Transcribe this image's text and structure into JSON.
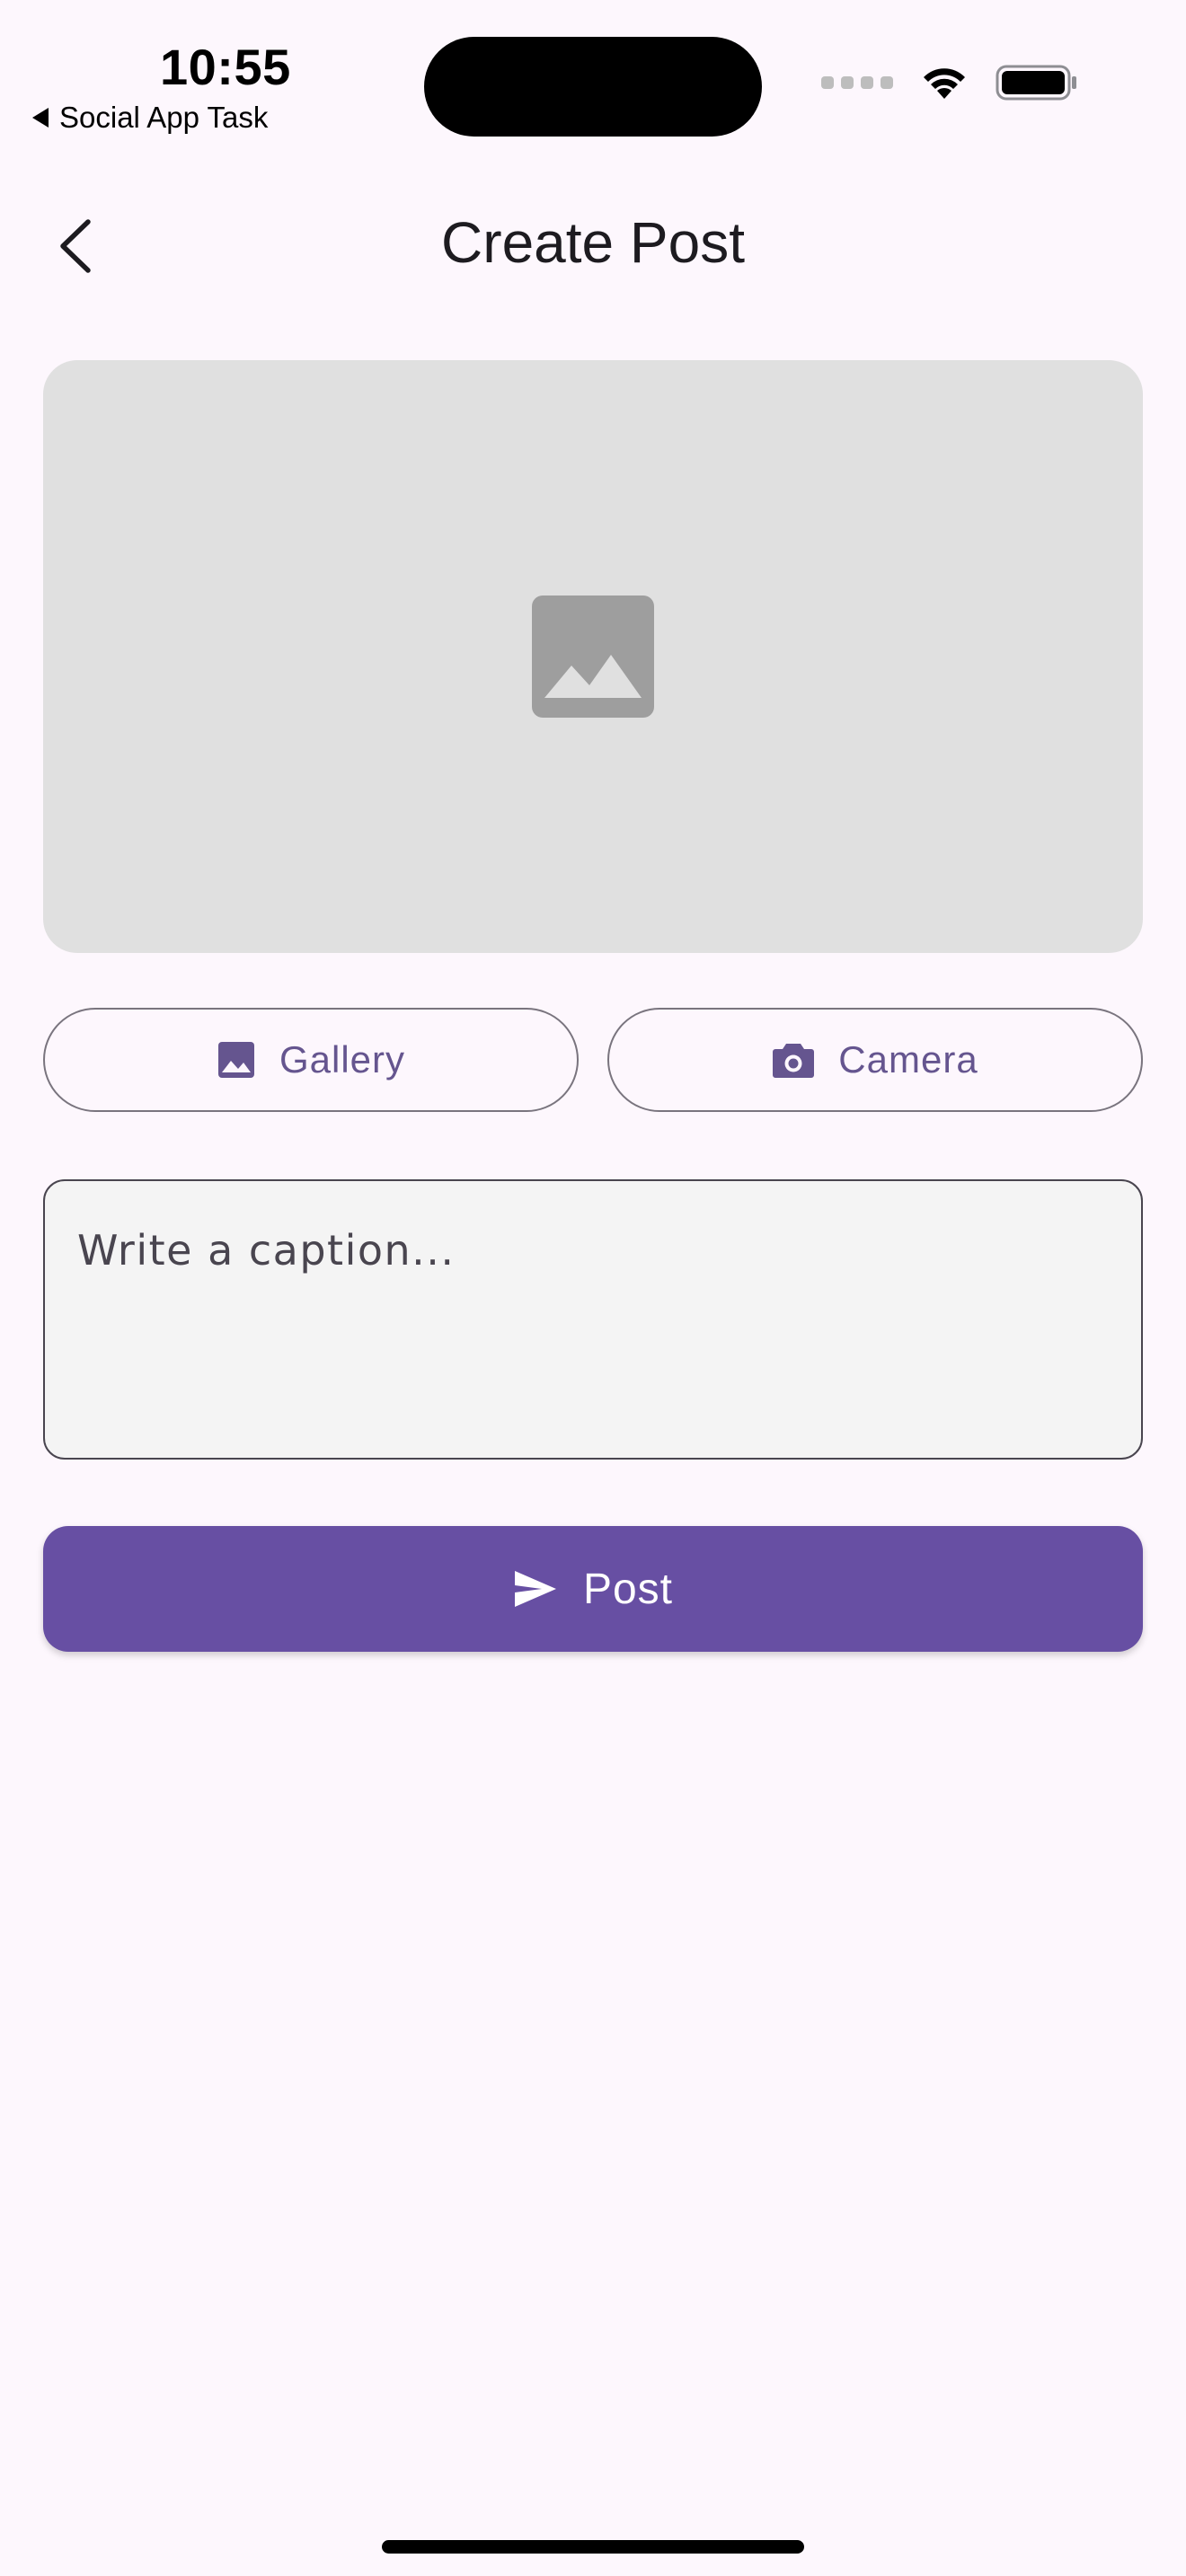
{
  "status_bar": {
    "time": "10:55",
    "back_app_label": "Social App Task"
  },
  "app_bar": {
    "title": "Create Post",
    "back_icon": "chevron-left-icon"
  },
  "image_preview": {
    "icon": "image-placeholder-icon"
  },
  "source_buttons": {
    "gallery_label": "Gallery",
    "gallery_icon": "image-icon",
    "camera_label": "Camera",
    "camera_icon": "camera-icon"
  },
  "caption": {
    "placeholder": "Write a caption...",
    "value": ""
  },
  "post_button": {
    "label": "Post",
    "icon": "send-icon"
  },
  "colors": {
    "background": "#FDF7FD",
    "primary": "#674FA3",
    "outline": "#79747E",
    "placeholder_bg": "#E0E0E0",
    "field_bg": "#F4F4F4"
  }
}
